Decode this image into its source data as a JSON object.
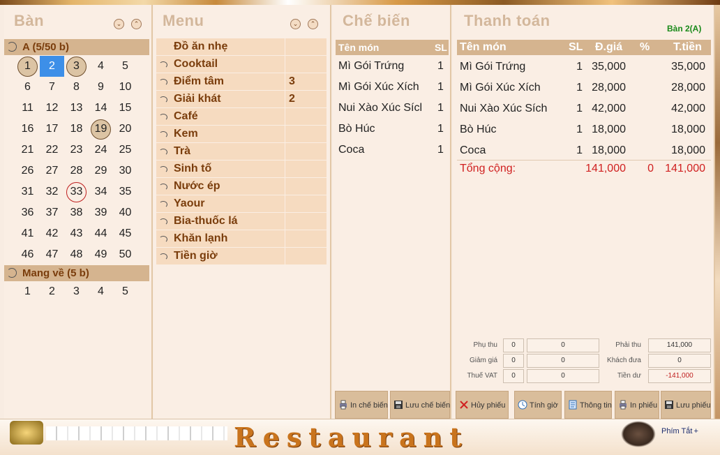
{
  "ban": {
    "title": "Bàn",
    "group_a": "A (5/50 b)",
    "group_a_tables": [
      "1",
      "2",
      "3",
      "4",
      "5",
      "6",
      "7",
      "8",
      "9",
      "10",
      "11",
      "12",
      "13",
      "14",
      "15",
      "16",
      "17",
      "18",
      "19",
      "20",
      "21",
      "22",
      "23",
      "24",
      "25",
      "26",
      "27",
      "28",
      "29",
      "30",
      "31",
      "32",
      "33",
      "34",
      "35",
      "36",
      "37",
      "38",
      "39",
      "40",
      "41",
      "42",
      "43",
      "44",
      "45",
      "46",
      "47",
      "48",
      "49",
      "50"
    ],
    "group_b": "Mang về (5 b)",
    "group_b_tables": [
      "1",
      "2",
      "3",
      "4",
      "5"
    ]
  },
  "menu": {
    "title": "Menu",
    "items": [
      {
        "name": "Đồ ăn nhẹ",
        "count": ""
      },
      {
        "name": "Cooktail",
        "count": ""
      },
      {
        "name": "Điểm tâm",
        "count": "3"
      },
      {
        "name": "Giải khát",
        "count": "2"
      },
      {
        "name": "Café",
        "count": ""
      },
      {
        "name": "Kem",
        "count": ""
      },
      {
        "name": "Trà",
        "count": ""
      },
      {
        "name": "Sinh tố",
        "count": ""
      },
      {
        "name": "Nước ép",
        "count": ""
      },
      {
        "name": "Yaour",
        "count": ""
      },
      {
        "name": "Bia-thuốc lá",
        "count": ""
      },
      {
        "name": "Khăn lạnh",
        "count": ""
      },
      {
        "name": "Tiền giờ",
        "count": ""
      }
    ]
  },
  "che_bien": {
    "title": "Chế biến",
    "col_name": "Tên món",
    "col_sl": "SL",
    "rows": [
      {
        "name": "Mì Gói Trứng",
        "sl": "1"
      },
      {
        "name": "Mì Gói Xúc Xích",
        "sl": "1"
      },
      {
        "name": "Nui Xào Xúc Sícl",
        "sl": "1"
      },
      {
        "name": "Bò Húc",
        "sl": "1"
      },
      {
        "name": "Coca",
        "sl": "1"
      }
    ],
    "btn_print": "In chế biến",
    "btn_save": "Lưu chế biến"
  },
  "thanh_toan": {
    "title": "Thanh toán",
    "table_label": "Bàn 2(A)",
    "col_name": "Tên món",
    "col_sl": "SL",
    "col_price": "Đ.giá",
    "col_pct": "%",
    "col_total": "T.tiền",
    "rows": [
      {
        "name": "Mì Gói Trứng",
        "sl": "1",
        "price": "35,000",
        "total": "35,000"
      },
      {
        "name": "Mì Gói Xúc Xích",
        "sl": "1",
        "price": "28,000",
        "total": "28,000"
      },
      {
        "name": "Nui Xào Xúc Sích",
        "sl": "1",
        "price": "42,000",
        "total": "42,000"
      },
      {
        "name": "Bò Húc",
        "sl": "1",
        "price": "18,000",
        "total": "18,000"
      },
      {
        "name": "Coca",
        "sl": "1",
        "price": "18,000",
        "total": "18,000"
      }
    ],
    "sum_label": "Tổng cộng:",
    "sum_price": "141,000",
    "sum_pct": "0",
    "sum_total": "141,000",
    "phu_thu_label": "Phụ thu",
    "phu_thu_pct": "0",
    "phu_thu_val": "0",
    "giam_gia_label": "Giảm giá",
    "giam_gia_pct": "0",
    "giam_gia_val": "0",
    "thue_label": "Thuế VAT",
    "thue_pct": "0",
    "thue_val": "0",
    "phai_thu_label": "Phải thu",
    "phai_thu_val": "141,000",
    "khach_dua_label": "Khách đưa",
    "khach_dua_val": "0",
    "tien_du_label": "Tiền dư",
    "tien_du_val": "-141,000",
    "btn_cancel": "Hủy phiếu",
    "btn_time": "Tính giờ",
    "btn_info": "Thông tin",
    "btn_print": "In phiếu",
    "btn_save": "Lưu phiếu"
  },
  "footer": {
    "brand": "Restaurant",
    "shortcut": "Phím Tắt"
  },
  "colors": {
    "header_bg": "#d5b48f",
    "accent_brown": "#7a3d0c",
    "selected_blue": "#3d8fe8",
    "total_red": "#d02020",
    "label_green": "#1a8a1a"
  }
}
